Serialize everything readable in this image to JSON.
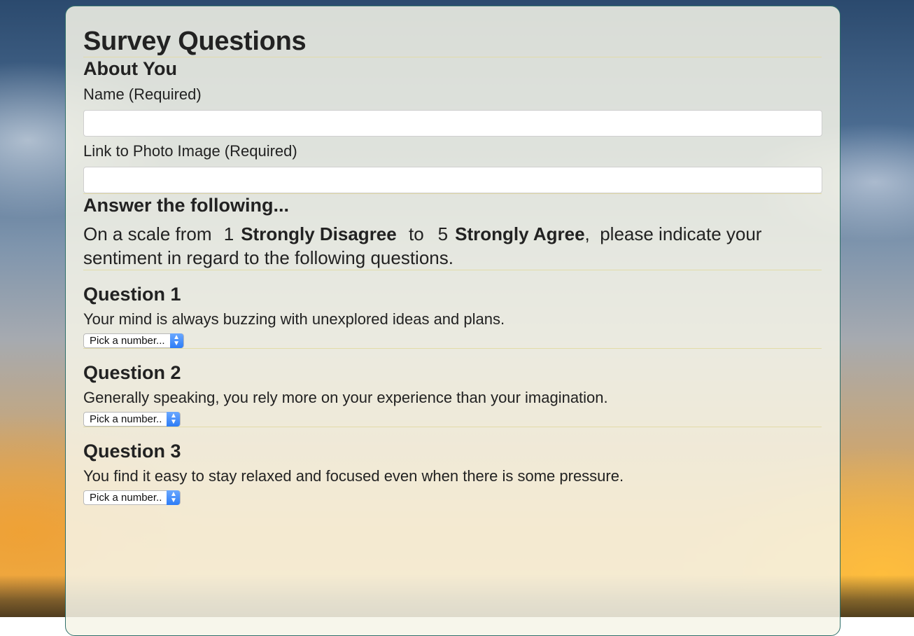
{
  "survey": {
    "title": "Survey Questions",
    "about": {
      "heading": "About You",
      "name_label": "Name (Required)",
      "name_value": "",
      "photo_label": "Link to Photo Image (Required)",
      "photo_value": ""
    },
    "answer": {
      "heading": "Answer the following...",
      "intro_prefix": "On a scale from",
      "low_number": "1",
      "low_label": "Strongly Disagree",
      "to_word": "to",
      "high_number": "5",
      "high_label": "Strongly Agree",
      "intro_suffix": "please indicate your sentiment in regard to the following questions."
    },
    "questions": [
      {
        "title": "Question 1",
        "text": "Your mind is always buzzing with unexplored ideas and plans.",
        "select_value": "Pick a number..."
      },
      {
        "title": "Question 2",
        "text": "Generally speaking, you rely more on your experience than your imagination.",
        "select_value": "Pick a number.."
      },
      {
        "title": "Question 3",
        "text": "You find it easy to stay relaxed and focused even when there is some pressure.",
        "select_value": "Pick a number.."
      }
    ]
  },
  "icons": {
    "select_arrows": "chevron-up-down-icon"
  },
  "colors": {
    "panel_border": "#2f6f6a",
    "divider": "#e2dba9",
    "select_accent": "#2d7cf6"
  }
}
